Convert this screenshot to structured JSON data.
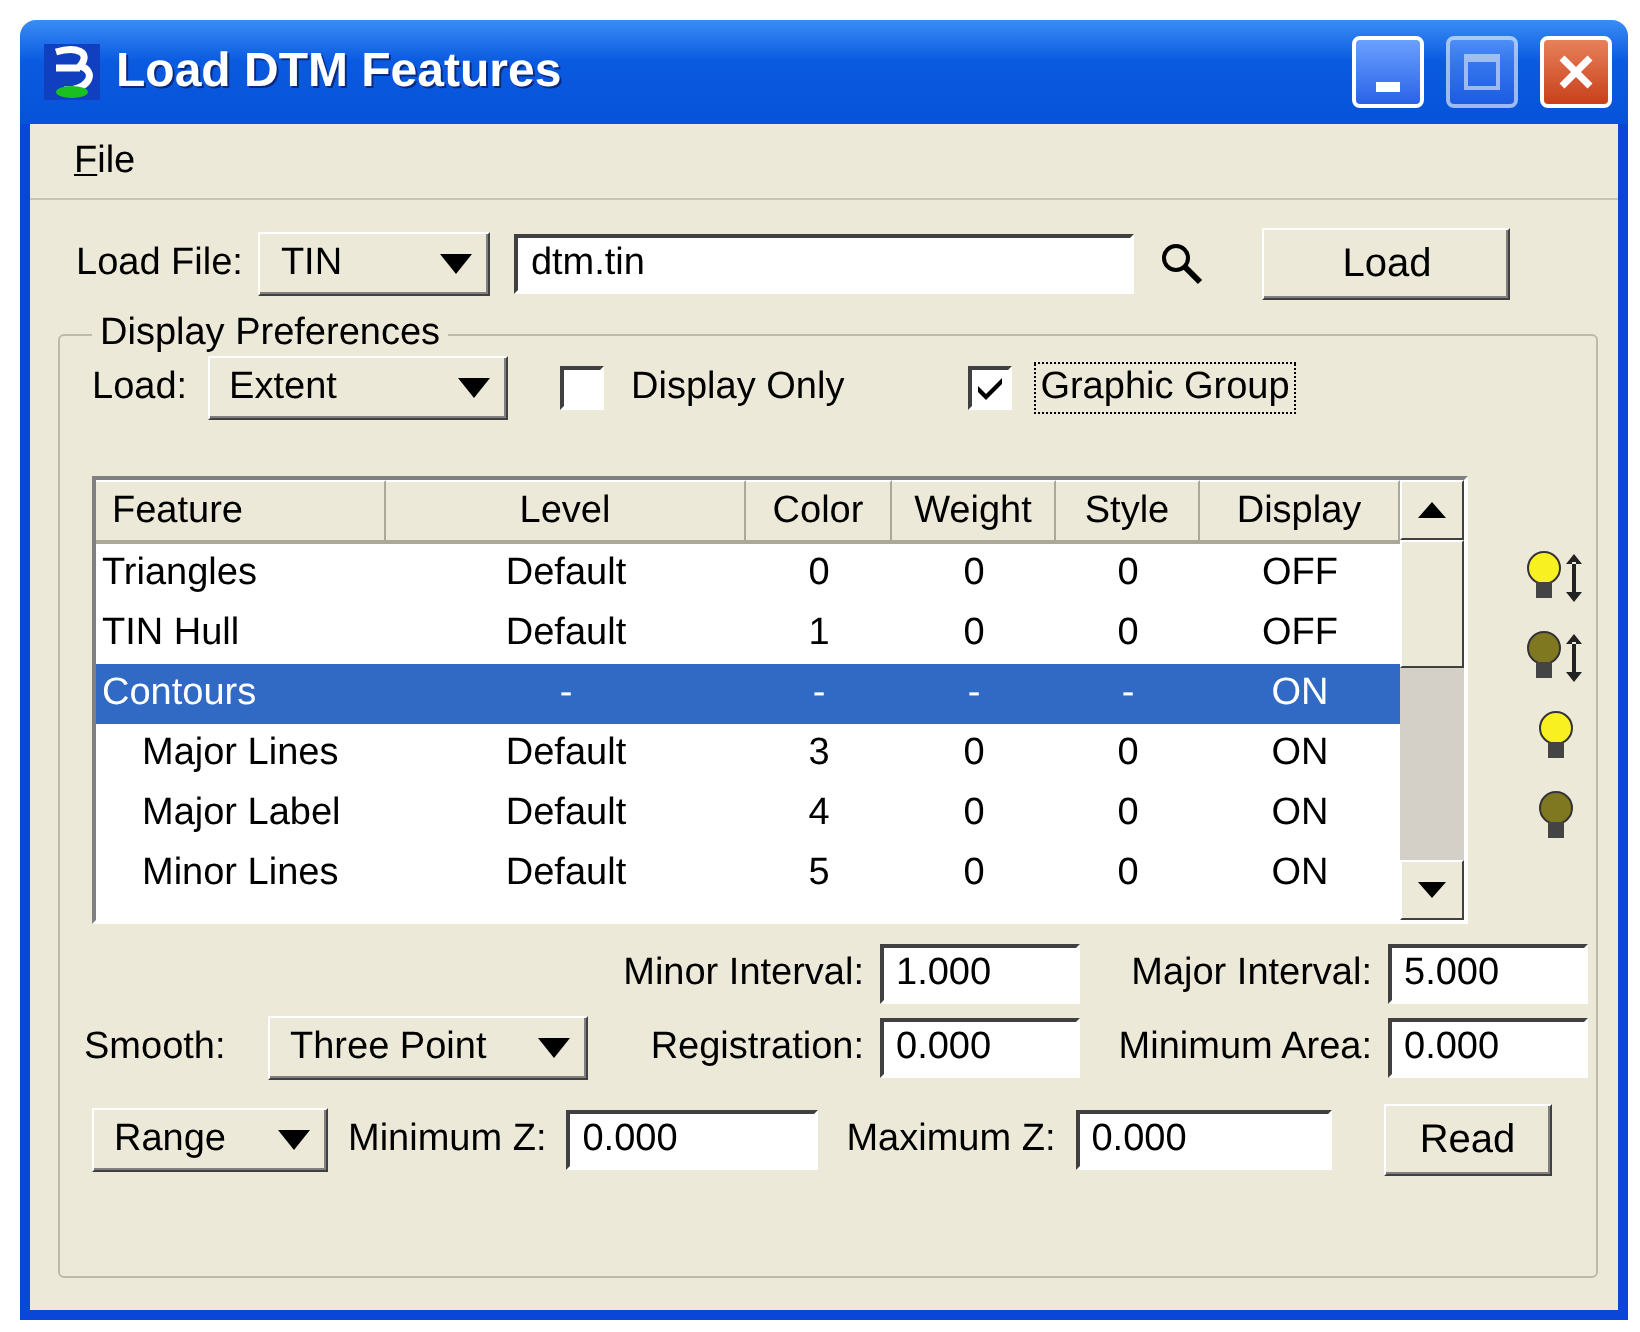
{
  "window": {
    "title": "Load DTM Features"
  },
  "menu": [
    {
      "label": "File"
    }
  ],
  "load_file": {
    "label": "Load File:",
    "type": "TIN",
    "path": "dtm.tin",
    "button": "Load"
  },
  "display_preferences": {
    "title": "Display Preferences",
    "load_label": "Load:",
    "load_mode": "Extent",
    "display_only": {
      "label": "Display Only",
      "checked": false
    },
    "graphic_group": {
      "label": "Graphic Group",
      "checked": true,
      "focused": true
    }
  },
  "table": {
    "columns": [
      "Feature",
      "Level",
      "Color",
      "Weight",
      "Style",
      "Display"
    ],
    "rows": [
      {
        "cells": [
          "Triangles",
          "Default",
          "0",
          "0",
          "0",
          "OFF"
        ],
        "selected": false
      },
      {
        "cells": [
          "TIN Hull",
          "Default",
          "1",
          "0",
          "0",
          "OFF"
        ],
        "selected": false
      },
      {
        "cells": [
          "Contours",
          "-",
          "-",
          "-",
          "-",
          "ON"
        ],
        "selected": true,
        "children": [
          {
            "cells": [
              "Major Lines",
              "Default",
              "3",
              "0",
              "0",
              "ON"
            ],
            "selected": false
          },
          {
            "cells": [
              "Major Label",
              "Default",
              "4",
              "0",
              "0",
              "ON"
            ],
            "selected": false
          },
          {
            "cells": [
              "Minor Lines",
              "Default",
              "5",
              "0",
              "0",
              "ON"
            ],
            "selected": false
          }
        ]
      }
    ]
  },
  "minor_interval": {
    "label": "Minor Interval:",
    "value": "1.000"
  },
  "major_interval": {
    "label": "Major Interval:",
    "value": "5.000"
  },
  "smooth": {
    "label": "Smooth:",
    "value": "Three Point"
  },
  "registration": {
    "label": "Registration:",
    "value": "0.000"
  },
  "minimum_area": {
    "label": "Minimum Area:",
    "value": "0.000"
  },
  "range": {
    "value": "Range"
  },
  "minimum_z": {
    "label": "Minimum Z:",
    "value": "0.000"
  },
  "maximum_z": {
    "label": "Maximum Z:",
    "value": "0.000"
  },
  "read_button": "Read"
}
